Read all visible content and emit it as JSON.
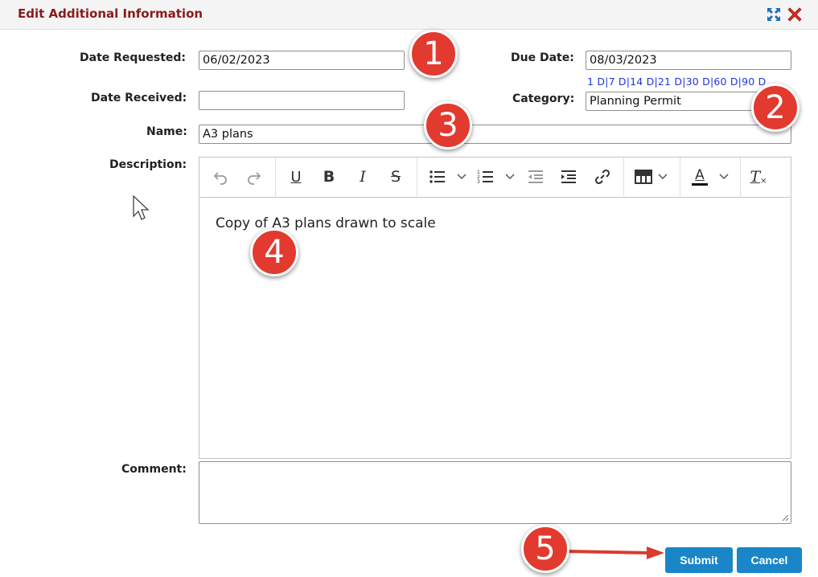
{
  "dialog": {
    "title": "Edit Additional Information"
  },
  "icons": {
    "expand": "expand-icon",
    "close": "close-icon"
  },
  "form": {
    "date_requested_label": "Date Requested:",
    "date_requested_value": "06/02/2023",
    "due_date_label": "Due Date:",
    "due_date_value": "08/03/2023",
    "quick_links": [
      "1 D",
      "7 D",
      "14 D",
      "21 D",
      "30 D",
      "60 D",
      "90 D"
    ],
    "date_received_label": "Date Received:",
    "date_received_value": "",
    "category_label": "Category:",
    "category_value": "Planning Permit",
    "name_label": "Name:",
    "name_value": "A3 plans",
    "description_label": "Description:",
    "description_text": "Copy of A3 plans drawn to scale",
    "comment_label": "Comment:",
    "comment_value": ""
  },
  "toolbar": {
    "items": [
      "undo",
      "redo",
      "underline",
      "bold",
      "italic",
      "strikethrough",
      "bulleted-list",
      "numbered-list",
      "outdent",
      "indent",
      "link",
      "table",
      "font-color",
      "remove-format"
    ],
    "underline_glyph": "U",
    "bold_glyph": "B",
    "italic_glyph": "I",
    "strike_glyph": "S",
    "font_color_glyph": "A",
    "remove_format_glyph": "T"
  },
  "buttons": {
    "submit": "Submit",
    "cancel": "Cancel"
  },
  "callouts": [
    "1",
    "2",
    "3",
    "4",
    "5"
  ],
  "colors": {
    "title": "#8b1a1a",
    "link": "#2233dd",
    "button": "#1a86c8",
    "badge": "#e23a2f",
    "arrow": "#e23a2f"
  }
}
